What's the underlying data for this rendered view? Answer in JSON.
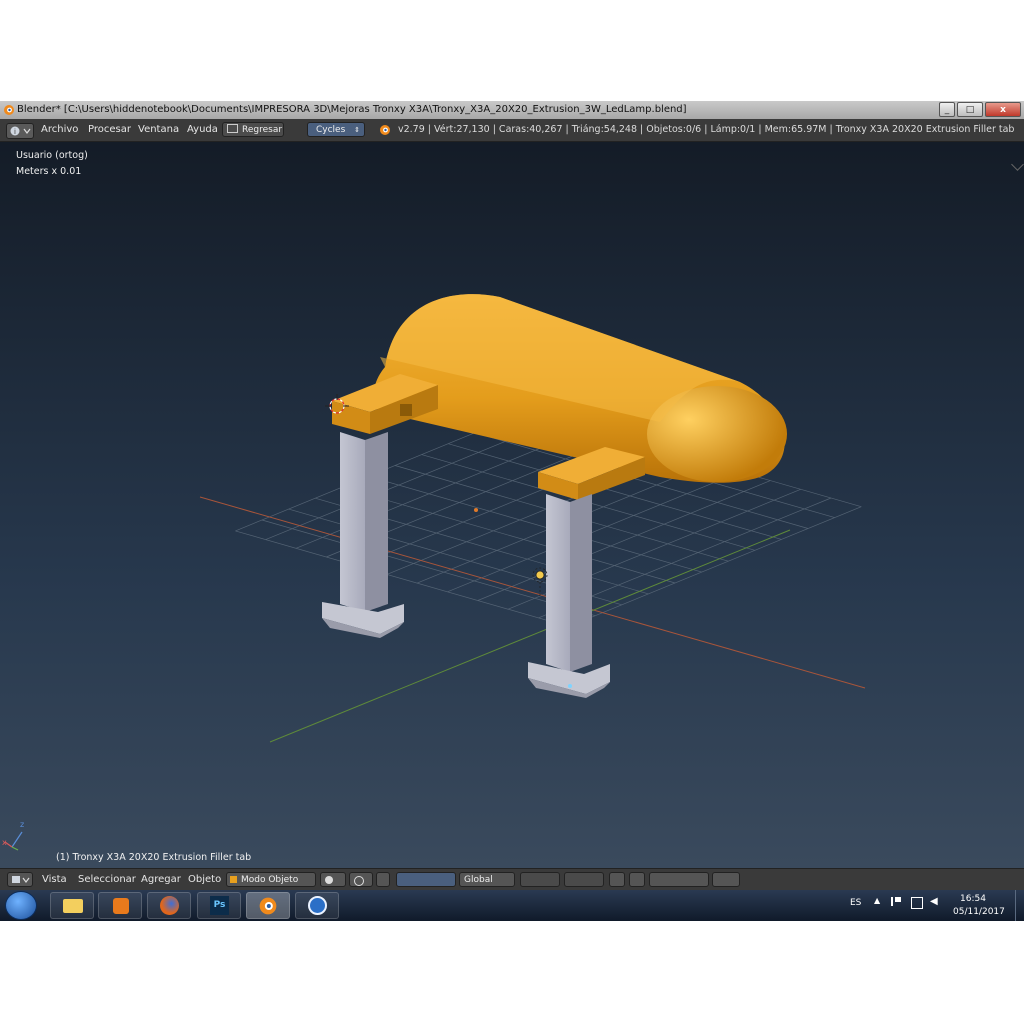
{
  "window": {
    "title": "Blender* [C:\\Users\\hiddenotebook\\Documents\\IMPRESORA 3D\\Mejoras Tronxy X3A\\Tronxy_X3A_20X20_Extrusion_3W_LedLamp.blend]",
    "close_glyph": "x",
    "max_glyph": "□",
    "min_glyph": "_"
  },
  "menu": {
    "items": [
      "Archivo",
      "Procesar",
      "Ventana",
      "Ayuda"
    ],
    "regresar": "Regresar",
    "engine": "Cycles",
    "stats": "v2.79 | Vért:27,130 | Caras:40,267 | Triáng:54,248 | Objetos:0/6 | Lámp:0/1 | Mem:65.97M | Tronxy X3A 20X20 Extrusion Filler tab"
  },
  "viewport": {
    "view_name": "Usuario (ortog)",
    "units": "Meters x 0.01",
    "object_label": "(1) Tronxy X3A 20X20 Extrusion Filler tab",
    "axis_x": "x",
    "axis_z": "z"
  },
  "footer": {
    "items": [
      "Vista",
      "Seleccionar",
      "Agregar",
      "Objeto"
    ],
    "mode": "Modo Objeto",
    "orientation": "Global"
  },
  "taskbar": {
    "lang": "ES",
    "time": "16:54",
    "date": "05/11/2017",
    "ps_label": "Ps"
  },
  "colors": {
    "accent_orange": "#e8a01e",
    "viewport_top": "#141c27",
    "header_bg": "#3a3a3a"
  }
}
